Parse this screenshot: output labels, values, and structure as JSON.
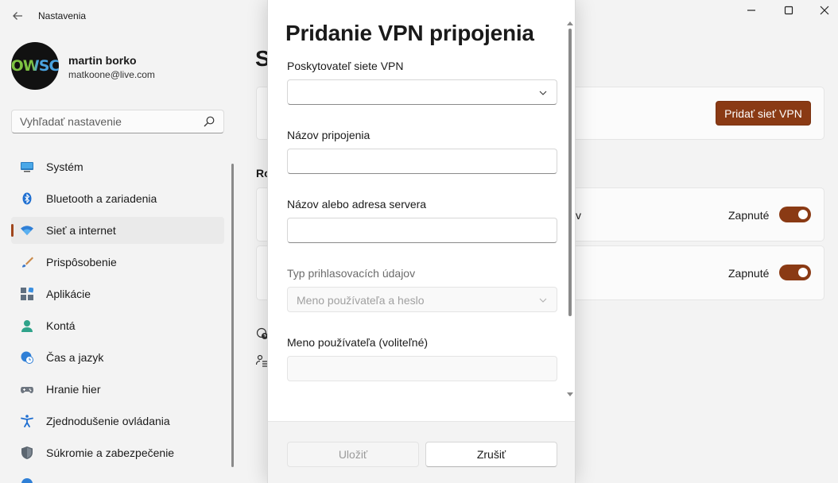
{
  "app": {
    "title": "Nastavenia"
  },
  "window": {
    "minimize": "—",
    "maximize": "☐",
    "close": "✕"
  },
  "user": {
    "name": "martin borko",
    "email": "matkoone@live.com",
    "avatar_text": "OWSC"
  },
  "search": {
    "placeholder": "Vyhľadať nastavenie"
  },
  "sidebar": {
    "items": [
      {
        "label": "Systém",
        "icon": "monitor-icon"
      },
      {
        "label": "Bluetooth a zariadenia",
        "icon": "bluetooth-icon"
      },
      {
        "label": "Sieť a internet",
        "icon": "wifi-icon",
        "active": true
      },
      {
        "label": "Prispôsobenie",
        "icon": "brush-icon"
      },
      {
        "label": "Aplikácie",
        "icon": "apps-icon"
      },
      {
        "label": "Kontá",
        "icon": "person-icon"
      },
      {
        "label": "Čas a jazyk",
        "icon": "globe-clock-icon"
      },
      {
        "label": "Hranie hier",
        "icon": "gamepad-icon"
      },
      {
        "label": "Zjednodušenie ovládania",
        "icon": "accessibility-icon"
      },
      {
        "label": "Súkromie a zabezpečenie",
        "icon": "shield-icon"
      }
    ]
  },
  "content": {
    "title_partial": "S",
    "add_vpn_label": "Pridať sieť VPN",
    "section_partial": "Ro",
    "row1_partial": "v",
    "toggle1_label": "Zapnuté",
    "toggle2_label": "Zapnuté",
    "toggle1_on": true,
    "toggle2_on": true
  },
  "dialog": {
    "title": "Pridanie VPN pripojenia",
    "fields": {
      "provider_label": "Poskytovateľ siete VPN",
      "provider_value": "",
      "connection_name_label": "Názov pripojenia",
      "connection_name_value": "",
      "server_label": "Názov alebo adresa servera",
      "server_value": "",
      "signin_type_label": "Typ prihlasovacích údajov",
      "signin_type_value": "Meno používateľa a heslo",
      "username_label": "Meno používateľa (voliteľné)",
      "username_value": ""
    },
    "save_label": "Uložiť",
    "cancel_label": "Zrušiť"
  },
  "colors": {
    "accent": "#8a3a14",
    "indicator": "#a0461c"
  }
}
